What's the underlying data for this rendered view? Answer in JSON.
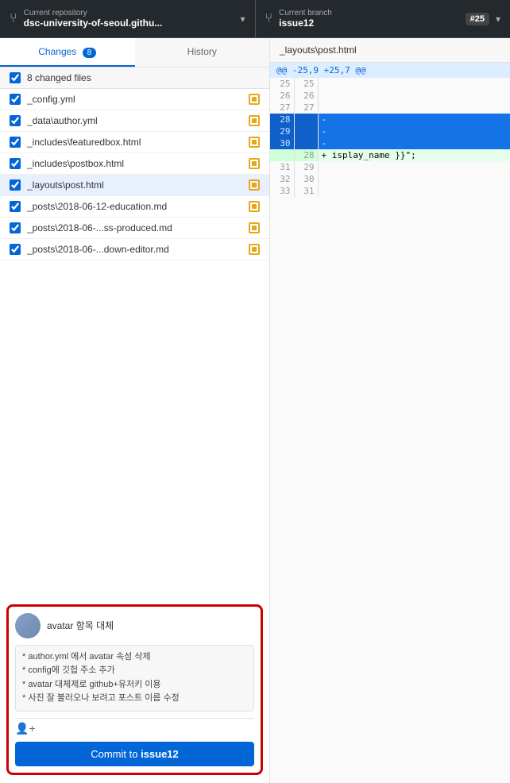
{
  "header": {
    "repo_label": "Current repository",
    "repo_name": "dsc-university-of-seoul.githu...",
    "branch_label": "Current branch",
    "branch_name": "issue12",
    "pr_number": "#25"
  },
  "tabs": {
    "changes_label": "Changes",
    "changes_count": "8",
    "history_label": "History"
  },
  "files_section": {
    "header_label": "8 changed files",
    "files": [
      {
        "name": "_config.yml",
        "checked": true,
        "selected": false
      },
      {
        "name": "_data\\author.yml",
        "checked": true,
        "selected": false
      },
      {
        "name": "_includes\\featuredbox.html",
        "checked": true,
        "selected": false
      },
      {
        "name": "_includes\\postbox.html",
        "checked": true,
        "selected": false
      },
      {
        "name": "_layouts\\post.html",
        "checked": true,
        "selected": true
      },
      {
        "name": "_posts\\2018-06-12-education.md",
        "checked": true,
        "selected": false
      },
      {
        "name": "_posts\\2018-06-...ss-produced.md",
        "checked": true,
        "selected": false
      },
      {
        "name": "_posts\\2018-06-...down-editor.md",
        "checked": true,
        "selected": false
      }
    ]
  },
  "diff": {
    "file_path": "_layouts\\post.html",
    "hunk_header": "@@ -25,9 +25,7 @@",
    "lines": [
      {
        "old_num": "25",
        "new_num": "25",
        "type": "context",
        "content": ""
      },
      {
        "old_num": "26",
        "new_num": "26",
        "type": "context",
        "content": ""
      },
      {
        "old_num": "27",
        "new_num": "27",
        "type": "context",
        "content": ""
      },
      {
        "old_num": "28",
        "new_num": "",
        "type": "highlighted",
        "content": "-"
      },
      {
        "old_num": "29",
        "new_num": "",
        "type": "highlighted",
        "content": "-"
      },
      {
        "old_num": "30",
        "new_num": "",
        "type": "highlighted",
        "content": "-"
      },
      {
        "old_num": "",
        "new_num": "28",
        "type": "added",
        "content": "+ isplay_name }}\";"
      },
      {
        "old_num": "31",
        "new_num": "29",
        "type": "context",
        "content": ""
      },
      {
        "old_num": "32",
        "new_num": "30",
        "type": "context",
        "content": ""
      },
      {
        "old_num": "33",
        "new_num": "31",
        "type": "context",
        "content": ""
      }
    ]
  },
  "commit": {
    "title_placeholder": "avatar 항목 대체",
    "description": "* author.yml 에서 avatar 속성 삭제\n* config에 깃헙 주소 추가\n* avatar 대체제로 github+유저키 이용\n* 사진 잘 불러오나 보려고 포스트 이름 수정",
    "button_label": "Commit to ",
    "button_branch": "issue12"
  }
}
